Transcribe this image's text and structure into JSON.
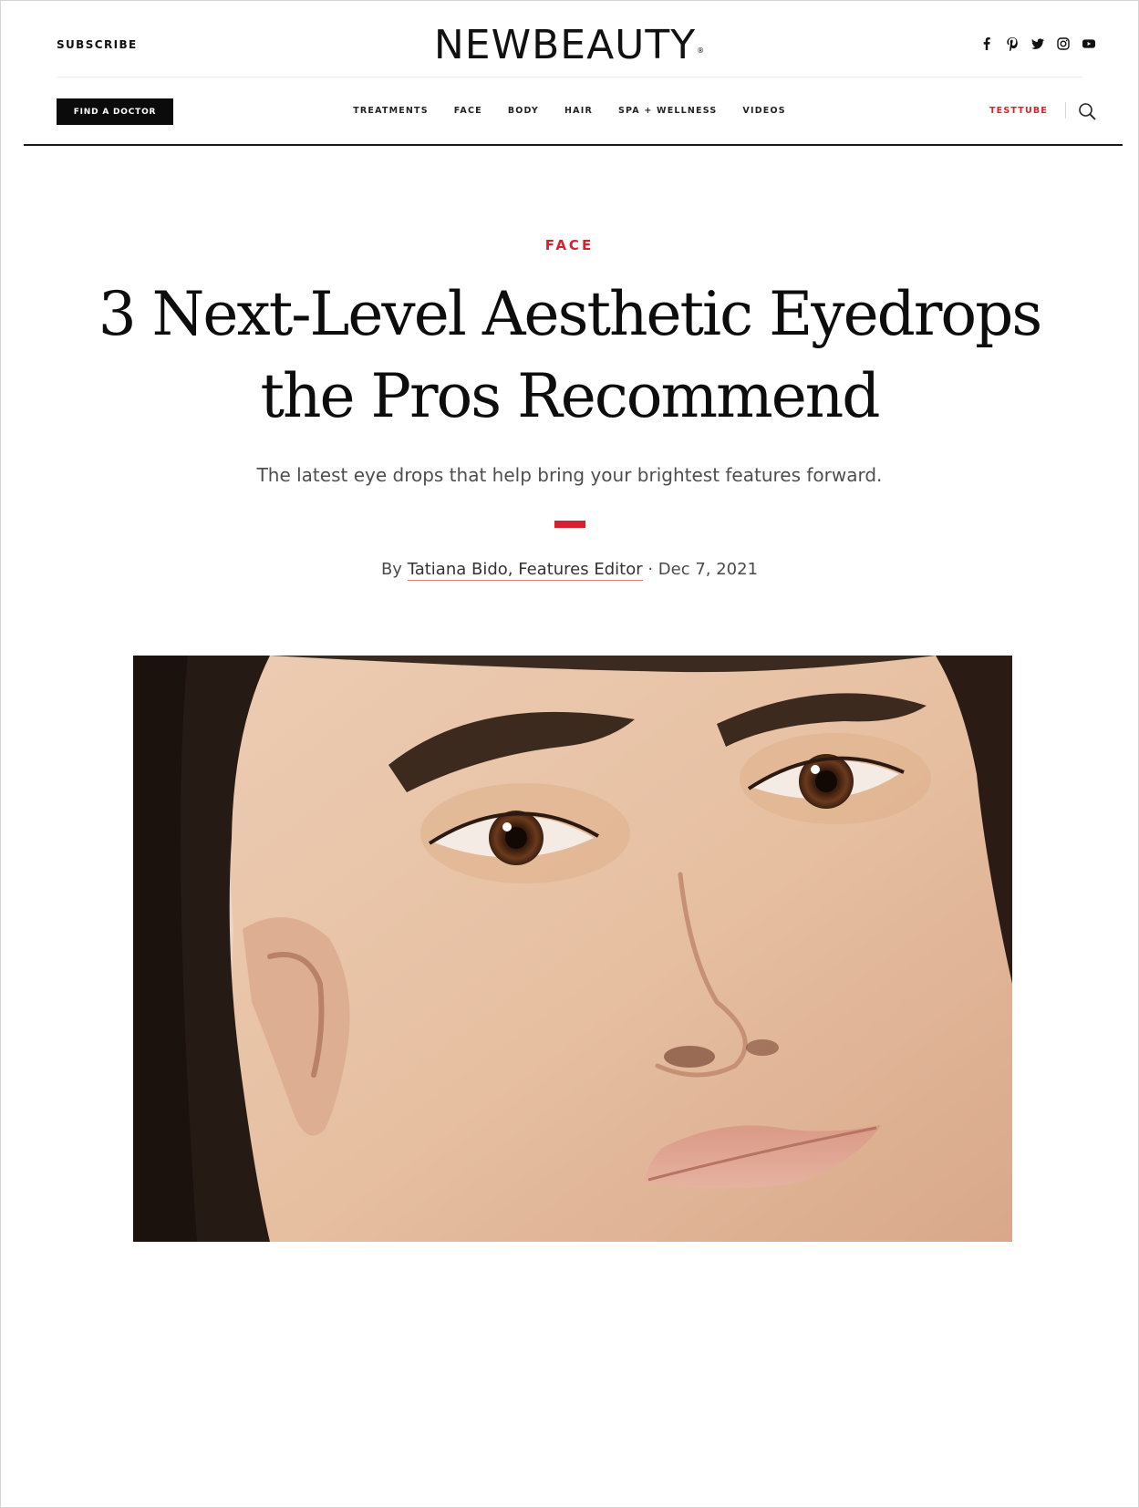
{
  "header": {
    "subscribe_label": "SUBSCRIBE",
    "logo_text": "NEWBEAUTY",
    "logo_mark": "®",
    "social_icons": [
      "facebook-icon",
      "pinterest-icon",
      "twitter-icon",
      "instagram-icon",
      "youtube-icon"
    ]
  },
  "nav": {
    "find_doctor_label": "FIND A DOCTOR",
    "items": [
      "TREATMENTS",
      "FACE",
      "BODY",
      "HAIR",
      "SPA + WELLNESS",
      "VIDEOS"
    ],
    "testtube_label": "TESTTUBE",
    "search_icon": "search-icon"
  },
  "article": {
    "category": "FACE",
    "title_line1": "3 Next-Level Aesthetic Eyedrops",
    "title_line2": "the Pros Recommend",
    "dek": "The latest eye drops that help bring your brightest features forward.",
    "byline_prefix": "By ",
    "author": "Tatiana Bido, Features Editor",
    "byline_separator": " · ",
    "date": "Dec 7, 2021"
  },
  "colors": {
    "accent_red": "#d9202e",
    "text_dark": "#111111",
    "button_black": "#0b0b0b"
  }
}
